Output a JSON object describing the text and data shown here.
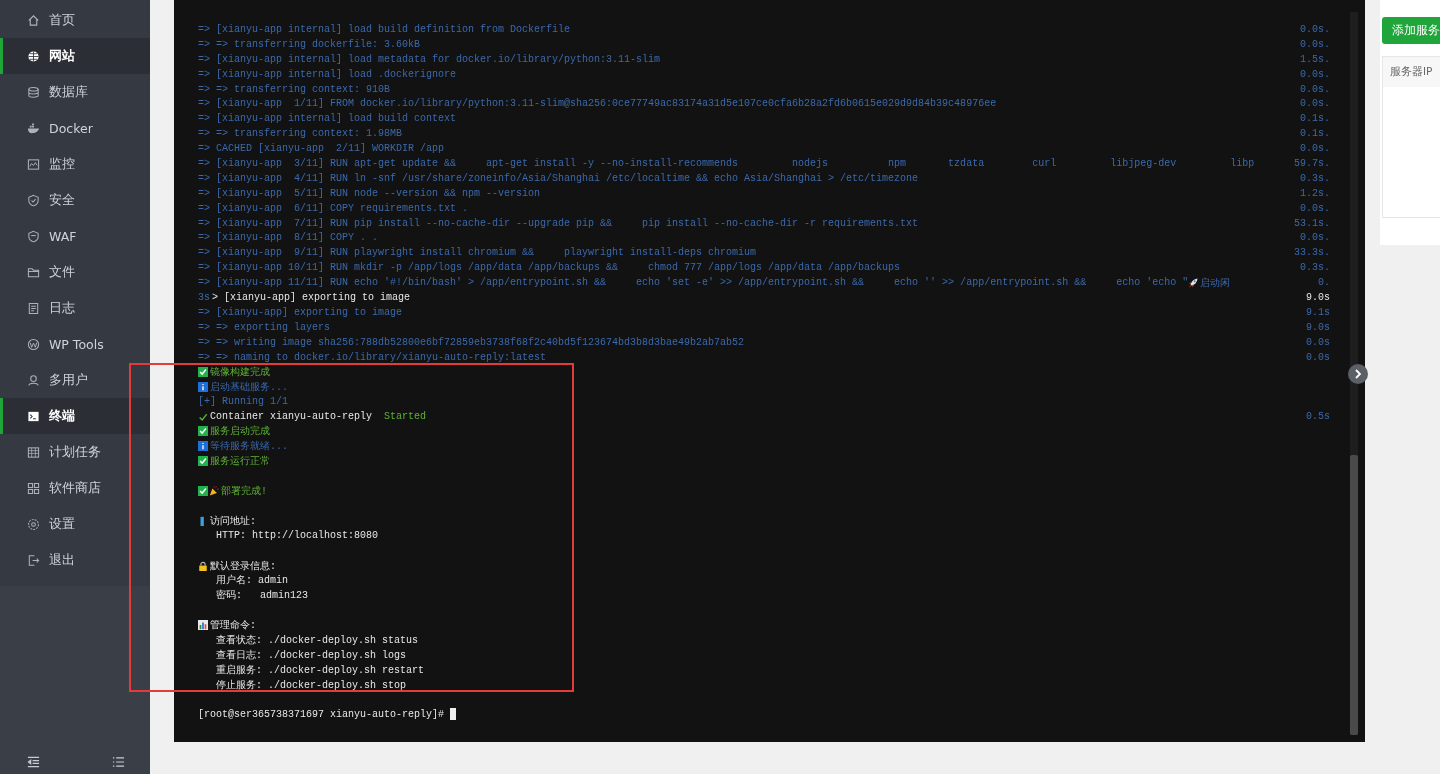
{
  "sidebar": {
    "items": [
      {
        "label": "首页",
        "selected": false
      },
      {
        "label": "网站",
        "selected": true
      },
      {
        "label": "数据库",
        "selected": false
      },
      {
        "label": "Docker",
        "selected": false
      },
      {
        "label": "监控",
        "selected": false
      },
      {
        "label": "安全",
        "selected": false
      },
      {
        "label": "WAF",
        "selected": false
      },
      {
        "label": "文件",
        "selected": false
      },
      {
        "label": "日志",
        "selected": false
      },
      {
        "label": "WP Tools",
        "selected": false
      },
      {
        "label": "多用户",
        "selected": false
      },
      {
        "label": "终端",
        "selected": true
      },
      {
        "label": "计划任务",
        "selected": false
      },
      {
        "label": "软件商店",
        "selected": false
      },
      {
        "label": "设置",
        "selected": false
      },
      {
        "label": "退出",
        "selected": false
      }
    ]
  },
  "terminal": {
    "lines": [
      {
        "kind": "log",
        "texts": [
          "=> [xianyu-app internal] load build definition from Dockerfile"
        ],
        "time": "0.0s."
      },
      {
        "kind": "log",
        "texts": [
          "=> => transferring dockerfile: 3.60kB"
        ],
        "time": "0.0s."
      },
      {
        "kind": "log",
        "texts": [
          "=> [xianyu-app internal] load metadata for docker.io/library/python:3.11-slim"
        ],
        "time": "1.5s."
      },
      {
        "kind": "log",
        "texts": [
          "=> [xianyu-app internal] load .dockerignore"
        ],
        "time": "0.0s."
      },
      {
        "kind": "log",
        "texts": [
          "=> => transferring context: 910B"
        ],
        "time": "0.0s."
      },
      {
        "kind": "log",
        "texts": [
          "=> [xianyu-app  1/11] FROM docker.io/library/python:3.11-slim@sha256:0ce77749ac83174a31d5e107ce0cfa6b28a2fd6b0615e029d9d84b39c48976ee"
        ],
        "time": "0.0s."
      },
      {
        "kind": "log",
        "texts": [
          "=> [xianyu-app internal] load build context"
        ],
        "time": "0.1s."
      },
      {
        "kind": "log",
        "texts": [
          "=> => transferring context: 1.98MB"
        ],
        "time": "0.1s."
      },
      {
        "kind": "log",
        "texts": [
          "=> CACHED [xianyu-app  2/11] WORKDIR /app"
        ],
        "time": "0.0s."
      },
      {
        "kind": "log",
        "texts": [
          "=> [xianyu-app  3/11] RUN apt-get update &&     apt-get install -y --no-install-recommends         nodejs          npm       tzdata        curl         libjpeg-dev         libp"
        ],
        "time": "59.7s."
      },
      {
        "kind": "log",
        "texts": [
          "=> [xianyu-app  4/11] RUN ln -snf /usr/share/zoneinfo/Asia/Shanghai /etc/localtime && echo Asia/Shanghai > /etc/timezone"
        ],
        "time": "0.3s."
      },
      {
        "kind": "log",
        "texts": [
          "=> [xianyu-app  5/11] RUN node --version && npm --version"
        ],
        "time": "1.2s."
      },
      {
        "kind": "log",
        "texts": [
          "=> [xianyu-app  6/11] COPY requirements.txt ."
        ],
        "time": "0.0s."
      },
      {
        "kind": "log",
        "texts": [
          "=> [xianyu-app  7/11] RUN pip install --no-cache-dir --upgrade pip &&     pip install --no-cache-dir -r requirements.txt"
        ],
        "time": "53.1s."
      },
      {
        "kind": "log",
        "texts": [
          "=> [xianyu-app  8/11] COPY . ."
        ],
        "time": "0.0s."
      },
      {
        "kind": "log",
        "texts": [
          "=> [xianyu-app  9/11] RUN playwright install chromium &&     playwright install-deps chromium"
        ],
        "time": "33.3s."
      },
      {
        "kind": "log",
        "texts": [
          "=> [xianyu-app 10/11] RUN mkdir -p /app/logs /app/data /app/backups &&     chmod 777 /app/logs /app/data /app/backups"
        ],
        "time": "0.3s."
      },
      {
        "kind": "launch",
        "texts": [
          "=> [xianyu-app 11/11] RUN echo '#!/bin/bash' > /app/entrypoint.sh &&     echo 'set -e' >> /app/entrypoint.sh &&     echo '' >> /app/entrypoint.sh &&     echo 'echo \"",
          "启动闲"
        ],
        "time": "0."
      },
      {
        "kind": "step",
        "texts": [
          "3s",
          "> [xianyu-app] exporting to image"
        ],
        "time": "9.0s"
      },
      {
        "kind": "log",
        "texts": [
          "=> [xianyu-app] exporting to image"
        ],
        "time": "9.1s"
      },
      {
        "kind": "log",
        "texts": [
          "=> => exporting layers"
        ],
        "time": "9.0s"
      },
      {
        "kind": "log",
        "texts": [
          "=> => writing image sha256:788db52800e6bf72859eb3738f68f2c40bd5f123674bd3b8d3bae49b2ab7ab52"
        ],
        "time": "0.0s"
      },
      {
        "kind": "log",
        "texts": [
          "=> => naming to docker.io/library/xianyu-auto-reply:latest"
        ],
        "time": "0.0s"
      },
      {
        "kind": "success",
        "texts": [
          "镜像构建完成"
        ]
      },
      {
        "kind": "info",
        "texts": [
          "启动基础服务..."
        ]
      },
      {
        "kind": "log",
        "texts": [
          "[+] Running 1/1"
        ]
      },
      {
        "kind": "started",
        "texts": [
          "Container xianyu-auto-reply",
          "Started"
        ],
        "time": "0.5s"
      },
      {
        "kind": "success",
        "texts": [
          "服务启动完成"
        ]
      },
      {
        "kind": "info",
        "texts": [
          "等待服务就绪..."
        ]
      },
      {
        "kind": "success",
        "texts": [
          "服务运行正常"
        ]
      },
      {
        "kind": "blank"
      },
      {
        "kind": "done",
        "texts": [
          "部署完成!"
        ]
      },
      {
        "kind": "blank"
      },
      {
        "kind": "address",
        "texts": [
          "访问地址:"
        ]
      },
      {
        "kind": "sub",
        "texts": [
          "HTTP: http://localhost:8080"
        ]
      },
      {
        "kind": "blank"
      },
      {
        "kind": "credentials",
        "texts": [
          "默认登录信息:"
        ]
      },
      {
        "kind": "sub",
        "texts": [
          "用户名: admin"
        ]
      },
      {
        "kind": "sub",
        "texts": [
          "密码:   admin123"
        ]
      },
      {
        "kind": "blank"
      },
      {
        "kind": "commands",
        "texts": [
          "管理命令:"
        ]
      },
      {
        "kind": "sub",
        "texts": [
          "查看状态: ./docker-deploy.sh status"
        ]
      },
      {
        "kind": "sub",
        "texts": [
          "查看日志: ./docker-deploy.sh logs"
        ]
      },
      {
        "kind": "sub",
        "texts": [
          "重启服务: ./docker-deploy.sh restart"
        ]
      },
      {
        "kind": "sub",
        "texts": [
          "停止服务: ./docker-deploy.sh stop"
        ]
      },
      {
        "kind": "blank"
      },
      {
        "kind": "prompt",
        "texts": [
          "[root@ser365738371697 xianyu-auto-reply]#"
        ]
      }
    ]
  },
  "right_panel": {
    "button": "添加服务",
    "table": {
      "columns": [
        "服务器IP"
      ]
    }
  }
}
